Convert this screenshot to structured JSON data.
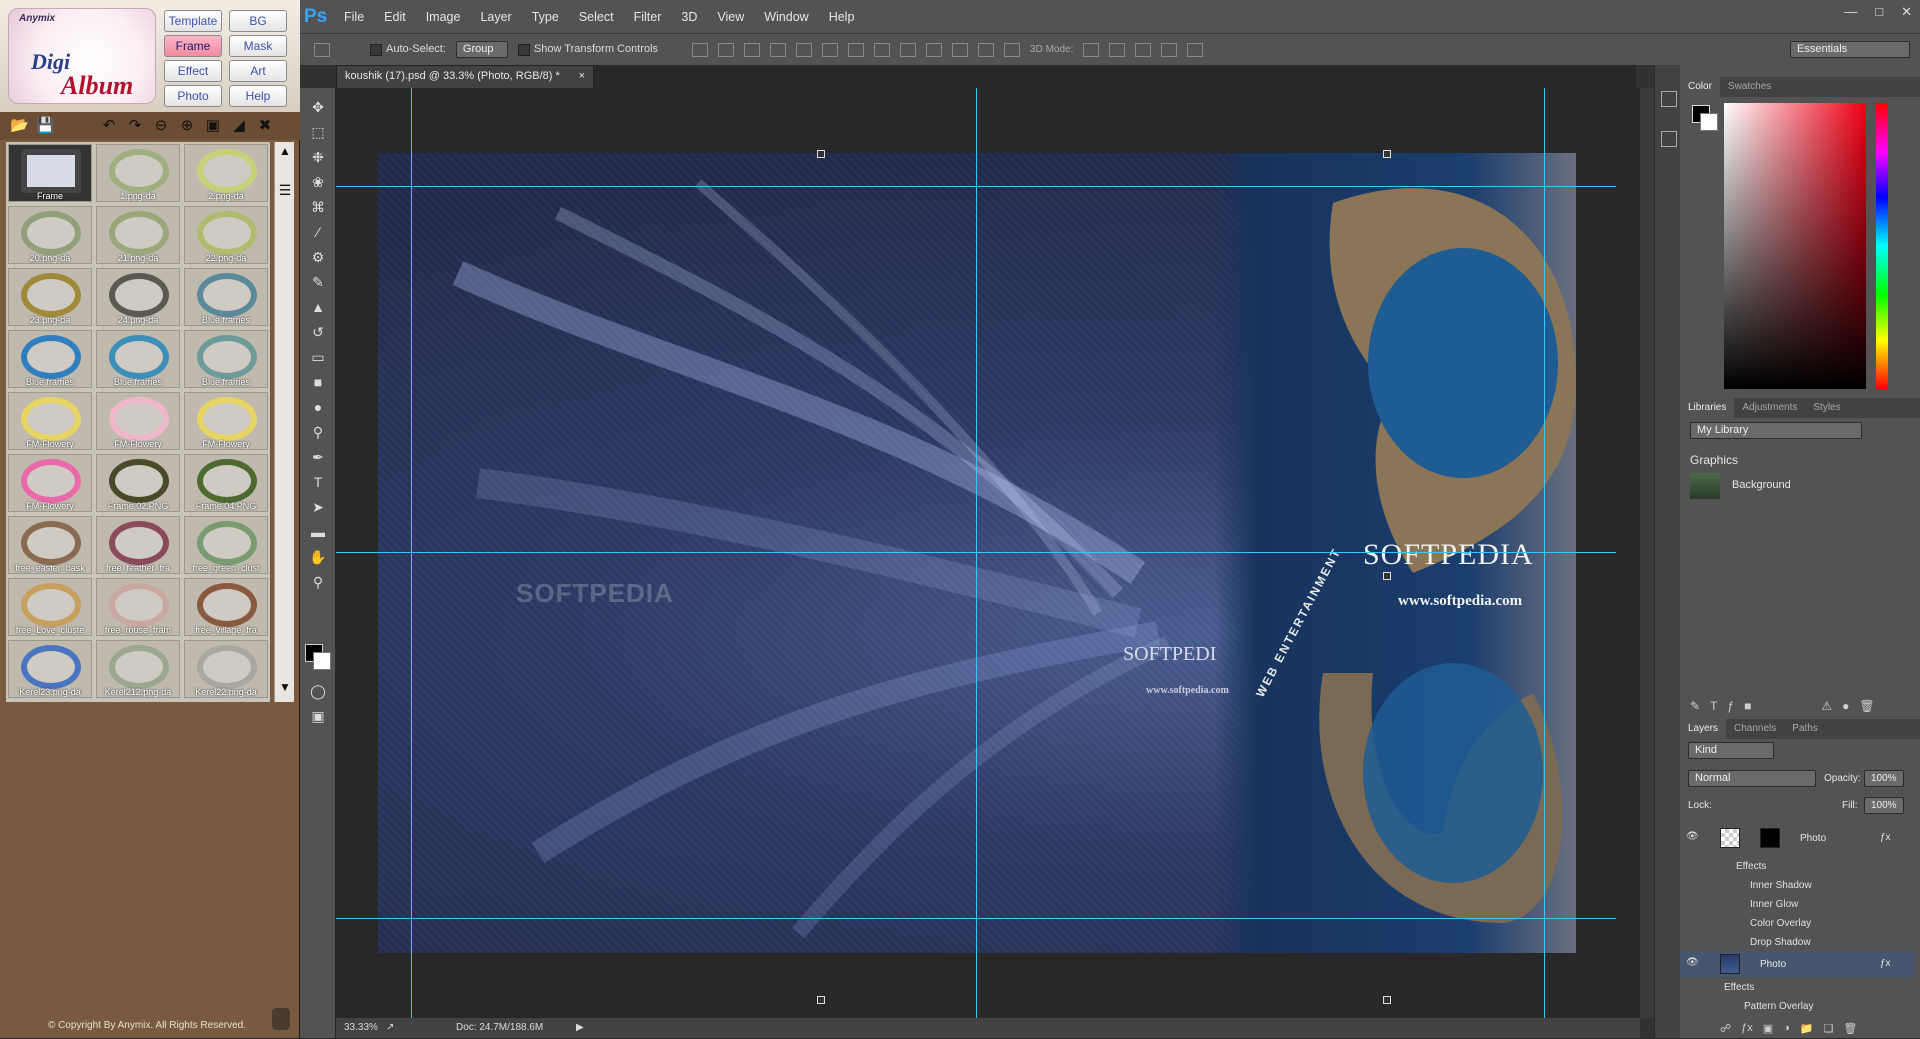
{
  "plugin": {
    "brand": "Anymix",
    "logo_word1": "Digi",
    "logo_word2": "Album",
    "buttons": [
      "Template",
      "BG",
      "Frame",
      "Mask",
      "Effect",
      "Art",
      "Photo",
      "Help"
    ],
    "active_button": "Frame",
    "thumbs": [
      "Frame",
      "1.png-da",
      "2.png-da",
      "20.png-da",
      "21.png-da",
      "22.png-da",
      "23.png-da",
      "24.png-da",
      "Blue frames",
      "Blue frames",
      "Blue frames",
      "Blue frames",
      "FM-Flowery",
      "FM-Flowery",
      "FM-Flowery",
      "FM-Flowery",
      "Frame 02.PNG",
      "Frame 04.PNG",
      "free_easter_bask",
      "free_feather_fra",
      "free_green_clust",
      "free_Love_cluste",
      "free_rouse_fram",
      "free_village_fra",
      "Kerel23.png-da",
      "Kerel212.png-da",
      "Kerel22.png-da"
    ],
    "copyright": "© Copyright By Anymix. All Rights Reserved.",
    "ring_colors": [
      "#2c2c55",
      "#9fb080",
      "#c8d07a",
      "#8fa07a",
      "#9aa77a",
      "#b0bb70",
      "#a08a3a",
      "#5a5a50",
      "#5a8a9a",
      "#2f7fc0",
      "#3b8fb8",
      "#6e9a9a",
      "#e6d560",
      "#f0b7cc",
      "#e6d560",
      "#e86aa8",
      "#4a4a2a",
      "#4e6a30",
      "#8a6a50",
      "#8a4a5a",
      "#7a9a70",
      "#c7a060",
      "#c8a8a0",
      "#8a5a40",
      "#4a74c0",
      "#9aa890",
      "#a8a8a0"
    ]
  },
  "ps": {
    "logo": "Ps",
    "menu": [
      "File",
      "Edit",
      "Image",
      "Layer",
      "Type",
      "Select",
      "Filter",
      "3D",
      "View",
      "Window",
      "Help"
    ],
    "options": {
      "auto_select": "Auto-Select:",
      "group": "Group",
      "transform": "Show Transform Controls",
      "mode3d": "3D Mode:",
      "workspace": "Essentials"
    },
    "doc_tab": "koushik (17).psd @ 33.3% (Photo, RGB/8) *",
    "zoom": "33.33%",
    "doc_size": "Doc: 24.7M/188.6M",
    "watermark": "SOFTPEDIA",
    "image": {
      "brand": "SOFTPEDIA",
      "url": "www.softpedia.com",
      "small_brand": "SOFTPEDI",
      "small_url": "www.softpedia.com",
      "tagline": "WEB ENTERTAINMENT"
    }
  },
  "panels": {
    "color_tabs": [
      "Color",
      "Swatches"
    ],
    "lib_tabs": [
      "Libraries",
      "Adjustments",
      "Styles"
    ],
    "library": "My Library",
    "graphics": "Graphics",
    "background": "Background",
    "layer_tabs": [
      "Layers",
      "Channels",
      "Paths"
    ],
    "kind": "Kind",
    "blend": "Normal",
    "opacity_label": "Opacity:",
    "opacity": "100%",
    "lock": "Lock:",
    "fill_label": "Fill:",
    "fill": "100%",
    "layer1": "Photo",
    "layer2": "Photo",
    "effects": "Effects",
    "effects_list": [
      "Inner Shadow",
      "Inner Glow",
      "Color Overlay",
      "Drop Shadow"
    ],
    "effects2": "Effects",
    "pattern": "Pattern Overlay"
  }
}
